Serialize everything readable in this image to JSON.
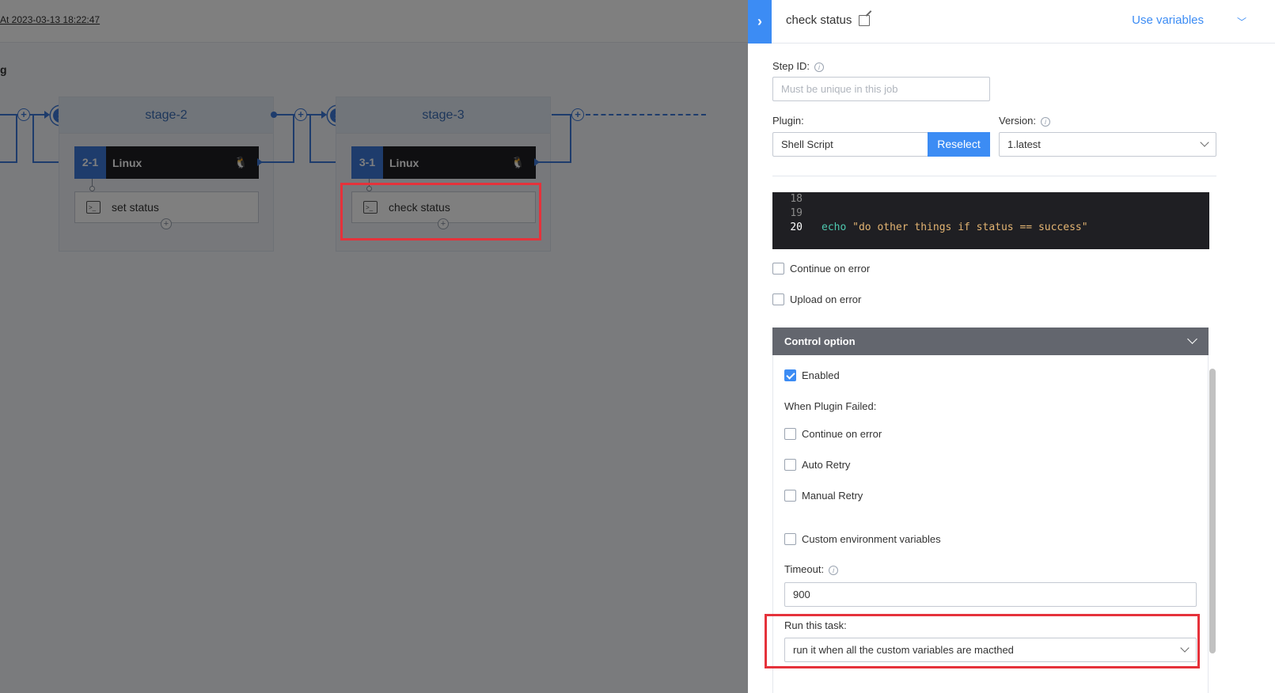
{
  "canvas": {
    "exec_time": "At 2023-03-13 18:22:47",
    "row_label": "g",
    "stages": [
      {
        "title": "stage-2",
        "job_num": "2-1",
        "job_name": "Linux",
        "task_name": "set status"
      },
      {
        "title": "stage-3",
        "job_num": "3-1",
        "job_name": "Linux",
        "task_name": "check status"
      }
    ],
    "os_icon": "linux-icon",
    "task_icon": "terminal-icon",
    "plus": "+",
    "bolt": "⚡",
    "os_glyph": "🐧",
    "task_glyph": ">_"
  },
  "panel": {
    "collapse_glyph": "›",
    "title": "check status",
    "edit_icon": "edit-icon",
    "use_variables": "Use variables",
    "use_variables_chevron": "﹀",
    "step_id_label": "Step ID:",
    "step_id_placeholder": "Must be unique in this job",
    "plugin_label": "Plugin:",
    "plugin_value": "Shell Script",
    "reselect_label": "Reselect",
    "version_label": "Version:",
    "version_value": "1.latest",
    "info_glyph": "i",
    "code": {
      "lines": [
        {
          "num": "18",
          "text": ""
        },
        {
          "num": "19",
          "text": ""
        },
        {
          "num": "20",
          "kw": "echo",
          "text": " \"do other things if status == success\""
        }
      ]
    },
    "continue_on_error": "Continue on error",
    "upload_on_error": "Upload on error",
    "control_option": {
      "title": "Control option",
      "enabled_label": "Enabled",
      "enabled_checked": true,
      "when_failed_label": "When Plugin Failed:",
      "failed_continue": "Continue on error",
      "auto_retry": "Auto Retry",
      "manual_retry": "Manual Retry",
      "custom_env": "Custom environment variables",
      "timeout_label": "Timeout:",
      "timeout_value": "900",
      "run_task_label": "Run this task:",
      "run_task_value": "run it when all the custom variables are macthed"
    }
  },
  "colors": {
    "accent": "#3c8cf4",
    "highlight": "#e5323b",
    "job_header": "#1f1f23",
    "stage_blue": "#3c78d8"
  }
}
